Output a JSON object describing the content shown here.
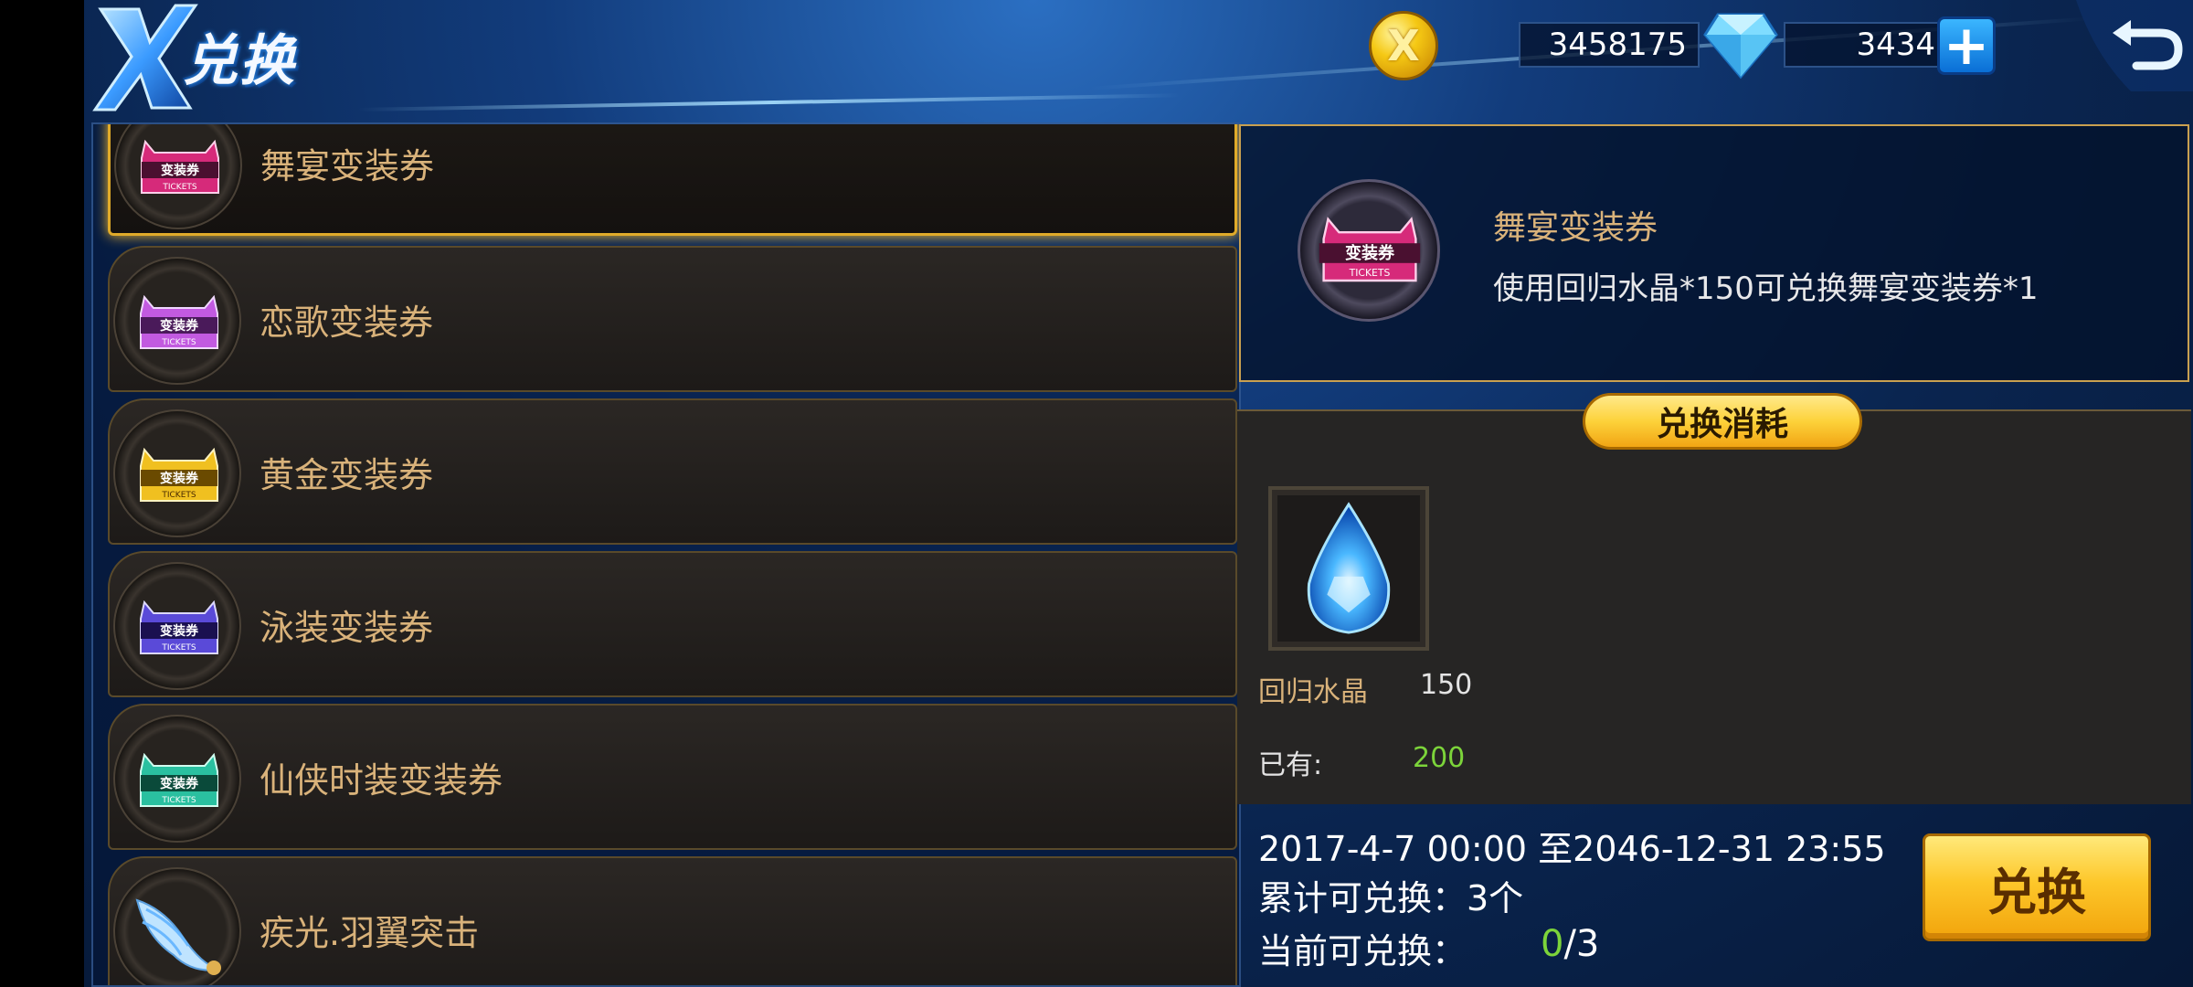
{
  "header": {
    "title": "兑换",
    "gold": "3458175",
    "gold_icon": "gold-x-coin-icon",
    "gems": "3434",
    "gem_icon": "diamond-icon"
  },
  "list": {
    "items": [
      {
        "name": "舞宴变装券",
        "icon": "ticket-icon",
        "ticket_color": "#d62a7a",
        "selected": true
      },
      {
        "name": "恋歌变装券",
        "icon": "ticket-icon",
        "ticket_color": "#c25ae0"
      },
      {
        "name": "黄金变装券",
        "icon": "ticket-icon",
        "ticket_color": "#f0c020"
      },
      {
        "name": "泳装变装券",
        "icon": "ticket-icon",
        "ticket_color": "#5a4ad8"
      },
      {
        "name": "仙侠时装变装券",
        "icon": "ticket-icon",
        "ticket_color": "#2ac0a0"
      },
      {
        "name": "疾光.羽翼突击",
        "icon": "wing-icon"
      }
    ]
  },
  "detail": {
    "title": "舞宴变装券",
    "description": "使用回归水晶*150可兑换舞宴变装券*1",
    "ticket_text": "变装券",
    "ticket_sub": "TICKETS"
  },
  "cost": {
    "header": "兑换消耗",
    "item_name": "回归水晶",
    "item_qty": "150",
    "item_icon": "blue-crystal-icon",
    "owned_label": "已有:",
    "owned_value": "200"
  },
  "info": {
    "period": "2017-4-7 00:00 至2046-12-31 23:55",
    "total": "累计可兑换：3个",
    "current_label": "当前可兑换：",
    "current_num": "0",
    "current_max": "/3"
  },
  "exchange_button": "兑换",
  "colors": {
    "accent_gold": "#e0ab2a",
    "text_gold": "#d9b27a",
    "green": "#7cd43a"
  }
}
